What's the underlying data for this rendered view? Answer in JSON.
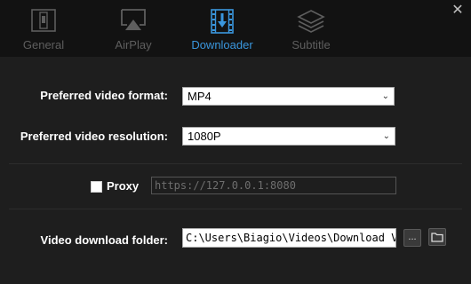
{
  "tabs": [
    {
      "label": "General",
      "icon": "phone-settings-icon",
      "active": false
    },
    {
      "label": "AirPlay",
      "icon": "airplay-icon",
      "active": false
    },
    {
      "label": "Downloader",
      "icon": "film-download-icon",
      "active": true
    },
    {
      "label": "Subtitle",
      "icon": "layers-icon",
      "active": false
    }
  ],
  "close_label": "✕",
  "form": {
    "format_label": "Preferred video format:",
    "format_value": "MP4",
    "resolution_label": "Preferred video resolution:",
    "resolution_value": "1080P",
    "proxy_label": "Proxy",
    "proxy_checked": false,
    "proxy_value": "https://127.0.0.1:8080",
    "folder_label": "Video download folder:",
    "folder_value": "C:\\Users\\Biagio\\Videos\\Download Vide",
    "browse_label": "..."
  },
  "colors": {
    "accent": "#3a96dd",
    "tab_inactive": "#5e5e5e",
    "background": "#1e1e1e",
    "tabbar": "#121212"
  }
}
